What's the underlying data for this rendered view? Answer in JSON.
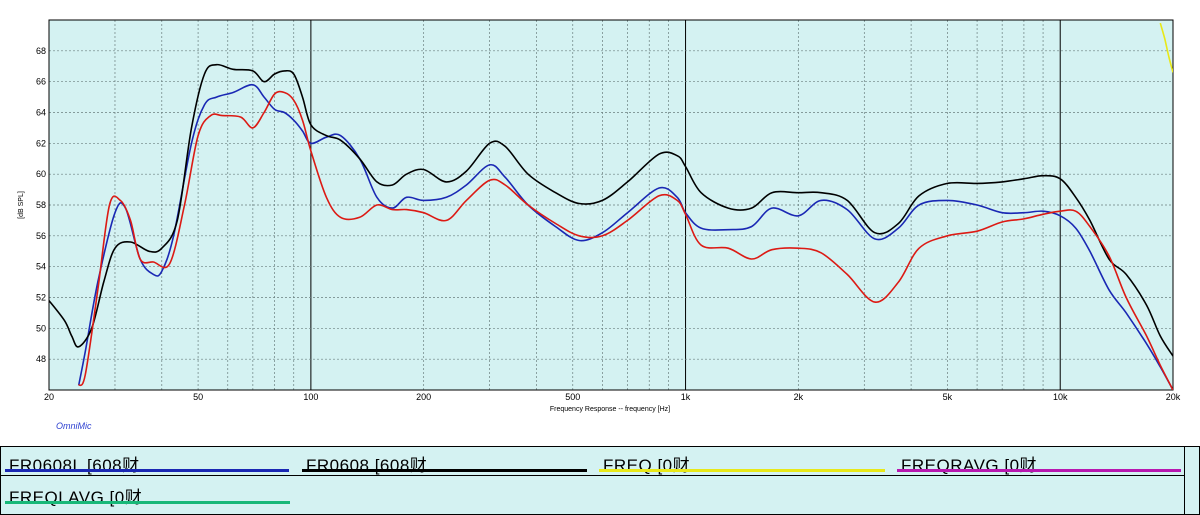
{
  "chart_data": {
    "type": "line",
    "xlabel": "Frequency Response -- frequency [Hz]",
    "ylabel": "[dB SPL]",
    "xscale": "log",
    "xlim": [
      20,
      20000
    ],
    "ylim": [
      46,
      70
    ],
    "x_ticks": [
      20,
      50,
      100,
      200,
      500,
      1000,
      2000,
      5000,
      10000,
      20000
    ],
    "x_tick_labels": [
      "20",
      "50",
      "100",
      "200",
      "500",
      "1k",
      "2k",
      "5k",
      "10k",
      "20k"
    ],
    "y_ticks": [
      48,
      50,
      52,
      54,
      56,
      58,
      60,
      62,
      64,
      66,
      68
    ],
    "y_tick_labels": [
      "48",
      "50",
      "52",
      "54",
      "56",
      "58",
      "60",
      "62",
      "64",
      "66",
      "68"
    ],
    "grid": true,
    "background": "#d4f2f2",
    "series": [
      {
        "name": "FR0608L [608财",
        "color": "#1a28b4",
        "x": [
          24,
          25,
          27,
          30,
          32,
          35,
          38,
          40,
          43,
          48,
          52,
          56,
          62,
          70,
          75,
          80,
          85,
          90,
          95,
          100,
          110,
          120,
          135,
          150,
          165,
          180,
          200,
          230,
          260,
          300,
          330,
          380,
          450,
          520,
          600,
          700,
          850,
          950,
          1000,
          1100,
          1300,
          1500,
          1700,
          2000,
          2300,
          2700,
          3200,
          3700,
          4200,
          5000,
          6000,
          7000,
          8000,
          9000,
          10000,
          11000,
          12000,
          13500,
          15000,
          17000,
          18500,
          20000
        ],
        "values": [
          46.3,
          48.5,
          53.0,
          57.5,
          57.8,
          54.5,
          53.5,
          53.7,
          56.0,
          62.0,
          64.5,
          65.0,
          65.3,
          65.8,
          65.0,
          64.2,
          64.0,
          63.5,
          62.8,
          62.0,
          62.4,
          62.5,
          61.0,
          58.5,
          57.8,
          58.5,
          58.3,
          58.5,
          59.3,
          60.6,
          59.8,
          58.0,
          56.6,
          55.7,
          56.2,
          57.5,
          59.1,
          58.5,
          57.5,
          56.5,
          56.4,
          56.6,
          57.8,
          57.3,
          58.3,
          57.7,
          55.8,
          56.5,
          58.0,
          58.3,
          58.0,
          57.5,
          57.5,
          57.6,
          57.3,
          56.5,
          55.0,
          52.5,
          51.0,
          49.0,
          47.5,
          46.0
        ]
      },
      {
        "name": "FR0608 [608财",
        "color": "#000000",
        "x": [
          20,
          22,
          23,
          24,
          26,
          28,
          30,
          33,
          37,
          40,
          44,
          48,
          52,
          56,
          62,
          70,
          75,
          80,
          85,
          90,
          95,
          100,
          110,
          120,
          135,
          150,
          165,
          180,
          200,
          230,
          260,
          300,
          330,
          380,
          450,
          520,
          600,
          700,
          850,
          950,
          1000,
          1100,
          1300,
          1500,
          1700,
          2000,
          2300,
          2700,
          3200,
          3700,
          4200,
          5000,
          6000,
          7000,
          8000,
          9000,
          10000,
          11000,
          12000,
          13500,
          15000,
          17000,
          18500,
          20000
        ],
        "values": [
          51.8,
          50.5,
          49.5,
          48.8,
          50.0,
          53.0,
          55.2,
          55.6,
          55.0,
          55.2,
          57.0,
          63.0,
          66.5,
          67.1,
          66.8,
          66.7,
          66.0,
          66.5,
          66.7,
          66.5,
          65.0,
          63.2,
          62.5,
          62.2,
          61.0,
          59.5,
          59.3,
          60.0,
          60.3,
          59.5,
          60.2,
          62.0,
          61.8,
          60.0,
          58.8,
          58.1,
          58.3,
          59.5,
          61.3,
          61.2,
          60.5,
          58.8,
          57.8,
          57.8,
          58.8,
          58.8,
          58.8,
          58.3,
          56.2,
          56.8,
          58.6,
          59.4,
          59.4,
          59.5,
          59.7,
          59.9,
          59.7,
          58.5,
          57.0,
          54.5,
          53.5,
          51.5,
          49.5,
          48.2
        ]
      },
      {
        "name": "FREQ [0财",
        "color": "#e8e818",
        "x": [
          18500,
          19000,
          19500,
          20000
        ],
        "values": [
          69.8,
          68.8,
          67.6,
          66.6
        ]
      },
      {
        "name": "FREQRAVG [0财",
        "color": "#b818b0",
        "x": [],
        "values": []
      },
      {
        "name": "FREQLAVG [0财",
        "color": "#18b878",
        "x": [],
        "values": []
      },
      {
        "name": "red",
        "color": "#dc1a14",
        "x": [
          24,
          25,
          27,
          29,
          31,
          33,
          35,
          38,
          42,
          46,
          50,
          54,
          58,
          65,
          70,
          75,
          80,
          85,
          90,
          95,
          100,
          110,
          120,
          135,
          150,
          165,
          180,
          200,
          230,
          260,
          300,
          330,
          380,
          450,
          520,
          600,
          700,
          850,
          950,
          1000,
          1100,
          1300,
          1500,
          1700,
          2000,
          2300,
          2700,
          3200,
          3700,
          4200,
          5000,
          6000,
          7000,
          8000,
          9000,
          10000,
          11000,
          12000,
          13500,
          15000,
          17000,
          18500,
          20000
        ],
        "values": [
          46.3,
          47.0,
          52.5,
          58.0,
          58.3,
          57.0,
          54.5,
          54.3,
          54.2,
          58.0,
          62.5,
          63.8,
          63.8,
          63.7,
          63.0,
          64.0,
          65.2,
          65.3,
          64.8,
          63.5,
          61.5,
          58.5,
          57.2,
          57.2,
          58.0,
          57.7,
          57.7,
          57.5,
          57.0,
          58.3,
          59.6,
          59.3,
          58.0,
          56.8,
          56.0,
          56.0,
          57.0,
          58.6,
          58.3,
          57.4,
          55.4,
          55.2,
          54.5,
          55.1,
          55.2,
          54.9,
          53.5,
          51.7,
          53.0,
          55.2,
          56.0,
          56.3,
          56.9,
          57.1,
          57.4,
          57.6,
          57.6,
          56.6,
          54.7,
          52.0,
          49.5,
          47.6,
          46.0
        ]
      }
    ]
  },
  "legend": [
    {
      "label": "FR0608L [608财",
      "color": "#1a28b4"
    },
    {
      "label": "FR0608 [608财",
      "color": "#000000"
    },
    {
      "label": "FREQ [0财",
      "color": "#e8e818"
    },
    {
      "label": "FREQRAVG [0财",
      "color": "#b818b0"
    },
    {
      "label": "FREQLAVG [0财",
      "color": "#18b878"
    }
  ],
  "brand": "OmniMic"
}
